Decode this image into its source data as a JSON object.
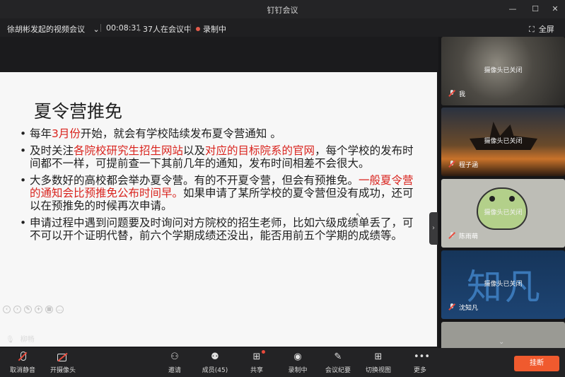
{
  "window": {
    "title": "钉钉会议",
    "minimize_icon": "minimize-icon",
    "maximize_icon": "maximize-icon",
    "close_icon": "close-icon"
  },
  "infobar": {
    "meeting_name": "徐胡彬发起的视频会议",
    "duration": "00:08:31",
    "participants_count": "37人在会议中",
    "recording": "录制中",
    "fullscreen": "全屏",
    "recording_color": "#e25b4a"
  },
  "slide": {
    "title": "夏令营推免",
    "bullets": [
      {
        "parts": [
          {
            "text": "每年",
            "red": false
          },
          {
            "text": "3月份",
            "red": true
          },
          {
            "text": "开始，就会有学校陆续发布夏令营通知 。",
            "red": false
          }
        ]
      },
      {
        "parts": [
          {
            "text": "及时关注",
            "red": false
          },
          {
            "text": "各院校研究生招生网站",
            "red": true
          },
          {
            "text": "以及",
            "red": false
          },
          {
            "text": "对应的目标院系的官网",
            "red": true
          },
          {
            "text": "，每个学校的发布时间都不一样，可提前查一下其前几年的通知，发布时间相差不会很大。",
            "red": false
          }
        ]
      },
      {
        "parts": [
          {
            "text": "大多数好的高校都会举办夏令营。有的不开夏令营，但会有预推免。",
            "red": false
          },
          {
            "text": "一般夏令营的通知会比预推免公布时间早。",
            "red": true
          },
          {
            "text": "如果申请了某所学校的夏令营但没有成功，还可以在预推免的时候再次申请。",
            "red": false
          }
        ]
      },
      {
        "parts": [
          {
            "text": "申请过程中遇到问题要及时询问对方院校的招生老师，比如六级成绩单丢了，可不可以开个证明代替，前六个学期成绩还没出，能否用前五个学期的成绩等。",
            "red": false
          }
        ]
      }
    ],
    "accent_color": "#d9231d"
  },
  "speaker": {
    "name": "柳畅"
  },
  "participants": [
    {
      "name": "我",
      "status": "摄像头已关闭"
    },
    {
      "name": "程子涵",
      "status": "摄像头已关闭"
    },
    {
      "name": "陈雨萌",
      "status": "摄像头已关闭"
    },
    {
      "name": "沈知凡",
      "status": "摄像头已关闭",
      "avatar_text": "知凡"
    }
  ],
  "toolbar": {
    "mute": "取消静音",
    "camera": "开摄像头",
    "invite": "邀请",
    "members": "成员(45)",
    "share": "共享",
    "record": "录制中",
    "minutes": "会议纪要",
    "layout": "切换视图",
    "more": "更多",
    "leave": "挂断",
    "leave_color": "#f05a2e"
  }
}
